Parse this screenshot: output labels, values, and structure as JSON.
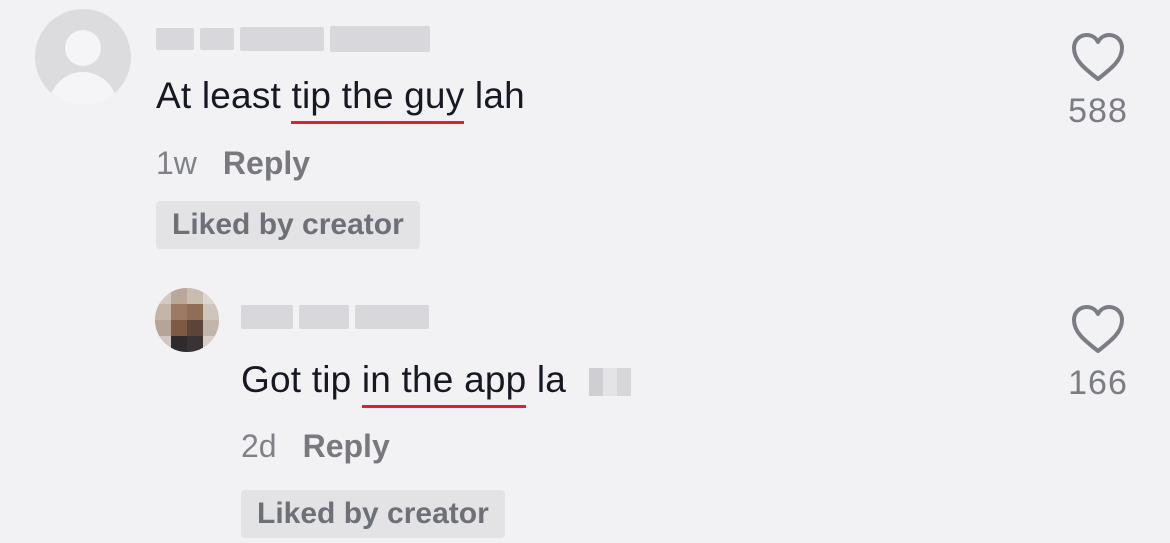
{
  "comments": [
    {
      "text_before": "At least ",
      "text_highlight": "tip the guy",
      "text_after": " lah",
      "time": "1w",
      "reply_label": "Reply",
      "badge": "Liked by creator",
      "likes": "588",
      "highlight_color": "#e0202e"
    },
    {
      "text_before": "Got tip ",
      "text_highlight": "in the app",
      "text_after": " la",
      "time": "2d",
      "reply_label": "Reply",
      "badge": "Liked by creator",
      "likes": "166",
      "highlight_color": "#e0202e"
    }
  ],
  "icons": {
    "like": "heart-outline-icon",
    "default_avatar": "user-silhouette-icon"
  },
  "colors": {
    "background": "#f2f2f4",
    "secondary_text": "#808289",
    "badge_bg": "#e3e3e6"
  }
}
